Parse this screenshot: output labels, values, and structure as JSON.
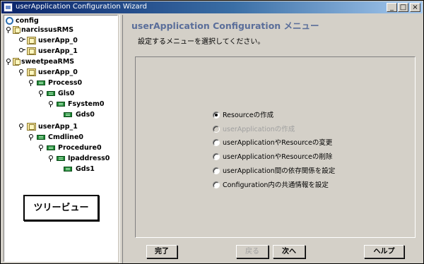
{
  "window": {
    "title": "userApplication Configuration Wizard",
    "controls": [
      "_",
      "□",
      "×"
    ]
  },
  "tree": {
    "root": "config",
    "nodes": [
      {
        "label": "narcissusRMS",
        "icon": "folder-icon"
      },
      {
        "label": "userApp_0",
        "icon": "folder-icon"
      },
      {
        "label": "userApp_1",
        "icon": "folder-icon"
      },
      {
        "label": "sweetpeaRMS",
        "icon": "folder-icon"
      },
      {
        "label": "userApp_0",
        "icon": "folder-icon"
      },
      {
        "label": "Process0",
        "icon": "resource-icon"
      },
      {
        "label": "Gls0",
        "icon": "resource-icon"
      },
      {
        "label": "Fsystem0",
        "icon": "resource-icon"
      },
      {
        "label": "Gds0",
        "icon": "resource-icon"
      },
      {
        "label": "userApp_1",
        "icon": "folder-icon"
      },
      {
        "label": "Cmdline0",
        "icon": "resource-icon"
      },
      {
        "label": "Procedure0",
        "icon": "resource-icon"
      },
      {
        "label": "Ipaddress0",
        "icon": "resource-icon"
      },
      {
        "label": "Gds1",
        "icon": "resource-icon"
      }
    ],
    "view_button": "ツリービュー"
  },
  "main": {
    "heading": "userApplication Configuration メニュー",
    "instruction": "設定するメニューを選択してください。",
    "options": [
      {
        "label": "Resourceの作成",
        "selected": true,
        "enabled": true
      },
      {
        "label": "userApplicationの作成",
        "selected": false,
        "enabled": false
      },
      {
        "label": "userApplicationやResourceの変更",
        "selected": false,
        "enabled": true
      },
      {
        "label": "userApplicationやResourceの削除",
        "selected": false,
        "enabled": true
      },
      {
        "label": "userApplication間の依存関係を設定",
        "selected": false,
        "enabled": true
      },
      {
        "label": "Configuration内の共通情報を設定",
        "selected": false,
        "enabled": true
      }
    ]
  },
  "buttons": {
    "finish": "完了",
    "back": "戻る",
    "next": "次へ",
    "help": "ヘルプ"
  }
}
